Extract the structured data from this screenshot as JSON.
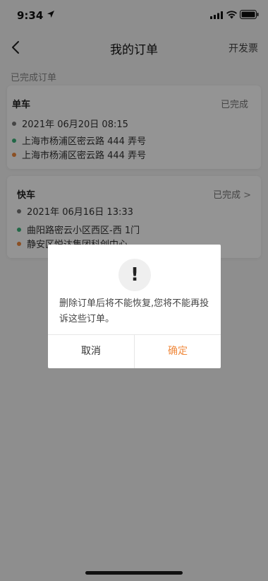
{
  "status_bar": {
    "time": "9:34"
  },
  "nav": {
    "title": "我的订单",
    "invoice": "开发票"
  },
  "section": {
    "label": "已完成订单"
  },
  "orders": [
    {
      "type": "单车",
      "status": "已完成",
      "time": "2021年 06月20日 08:15",
      "start": "上海市杨浦区密云路 444 弄号",
      "end": "上海市杨浦区密云路 444 弄号"
    },
    {
      "type": "快车",
      "status": "已完成",
      "chevron": ">",
      "time": "2021年 06月16日 13:33",
      "start": "曲阳路密云小区西区-西 1门",
      "end": "静安区悦达集团科创中心"
    }
  ],
  "dialog": {
    "icon": "!",
    "message": "删除订单后将不能恢复,您将不能再投诉这些订单。",
    "cancel": "取消",
    "confirm": "确定"
  },
  "colors": {
    "accent": "#f08a3e",
    "start_dot": "#3bb37a",
    "end_dot": "#f08a3e",
    "overlay": "rgba(0,0,0,0.42)"
  }
}
